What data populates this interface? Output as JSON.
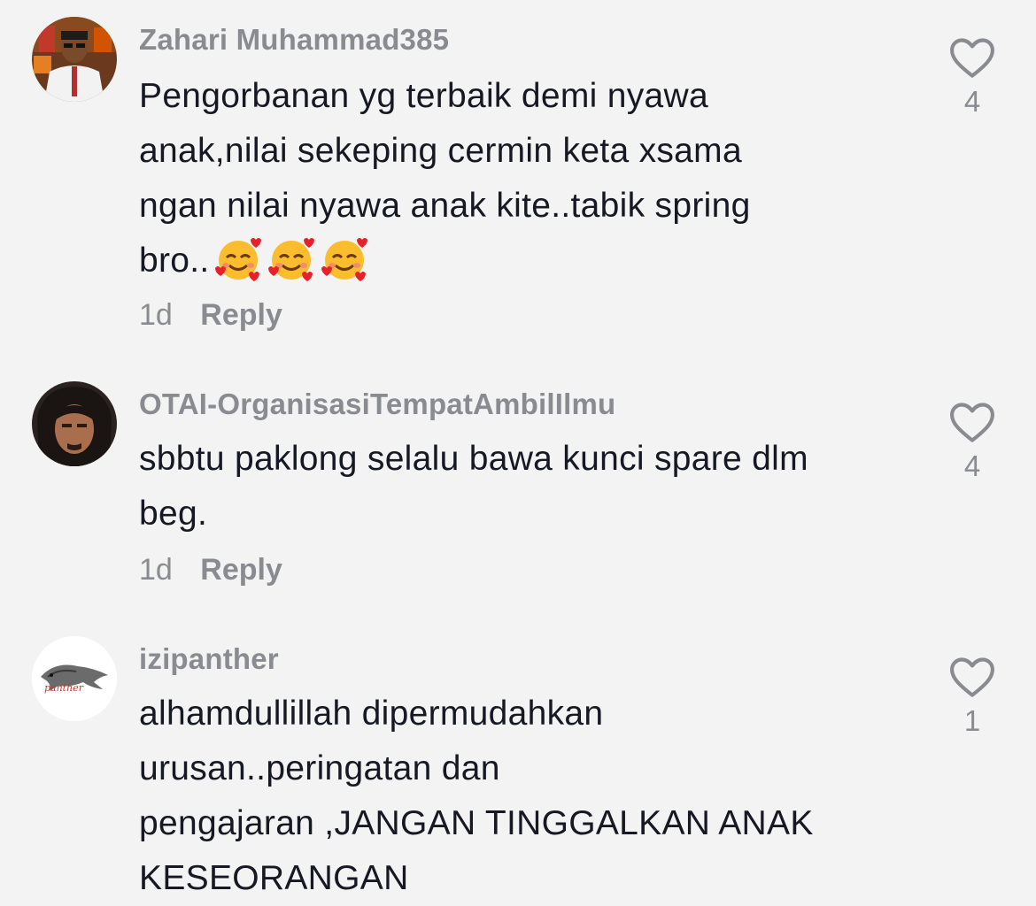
{
  "comments": [
    {
      "username": "Zahari Muhammad385",
      "text_lines": [
        "Pengorbanan yg terbaik demi nyawa",
        "anak,nilai sekeping cermin keta xsama",
        "ngan nilai nyawa anak kite..tabik spring",
        "bro.."
      ],
      "emoji": "🥰🥰🥰",
      "time": "1d",
      "reply_label": "Reply",
      "like_count": "4"
    },
    {
      "username": "OTAI-OrganisasiTempatAmbilIlmu",
      "text_lines": [
        "sbbtu paklong selalu bawa kunci spare dlm",
        "beg."
      ],
      "time": "1d",
      "reply_label": "Reply",
      "like_count": "4"
    },
    {
      "username": "izipanther",
      "avatar_label": "panther",
      "text_lines": [
        "alhamdullillah dipermudahkan",
        "urusan..peringatan dan",
        "pengajaran ,JANGAN TINGGALKAN ANAK",
        "KESEORANGAN"
      ],
      "like_count": "1"
    }
  ],
  "icons": {
    "like": "heart-outline-icon",
    "emoji": "smiling-face-with-hearts-emoji"
  },
  "colors": {
    "background": "#f3f3f3",
    "text": "#161823",
    "secondary": "#8a8b91"
  }
}
